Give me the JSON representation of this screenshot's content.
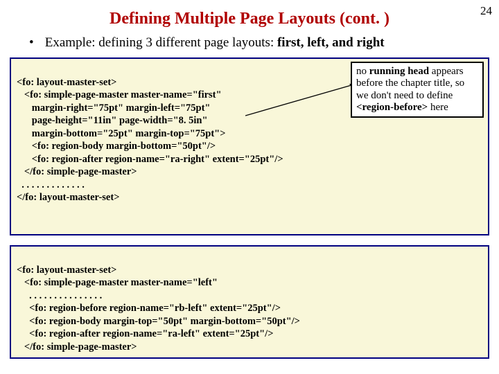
{
  "page_number": "24",
  "title": "Defining Multiple Page Layouts (cont. )",
  "bullet": {
    "prefix": "Example: defining 3 different page layouts: ",
    "bold_tail": "first, left, and right"
  },
  "code1": {
    "l1": "<fo: layout-master-set>",
    "l2": "   <fo: simple-page-master master-name=\"first\"",
    "l3": "      margin-right=\"75pt\" margin-left=\"75pt\"",
    "l4": "      page-height=\"11in\" page-width=\"8. 5in\"",
    "l5": "      margin-bottom=\"25pt\" margin-top=\"75pt\">",
    "l6": "      <fo: region-body margin-bottom=\"50pt\"/>",
    "l7": "      <fo: region-after region-name=\"ra-right\" extent=\"25pt\"/>",
    "l8": "   </fo: simple-page-master>",
    "l9": "  . . . . . . . . . . . . .",
    "l10": "</fo: layout-master-set>"
  },
  "callout": {
    "t1": "no ",
    "b1": "running head",
    "t2": " appears before the chapter title, so we don't need to define ",
    "b2": "<region-before>",
    "t3": " here"
  },
  "code2": {
    "l1": "<fo: layout-master-set>",
    "l2": "   <fo: simple-page-master master-name=\"left\"",
    "l3": "     . . . . . . . . . . . . . . .",
    "l4": "     <fo: region-before region-name=\"rb-left\" extent=\"25pt\"/>",
    "l5": "     <fo: region-body margin-top=\"50pt\" margin-bottom=\"50pt\"/>",
    "l6": "     <fo: region-after region-name=\"ra-left\" extent=\"25pt\"/>",
    "l7": "   </fo: simple-page-master>"
  }
}
